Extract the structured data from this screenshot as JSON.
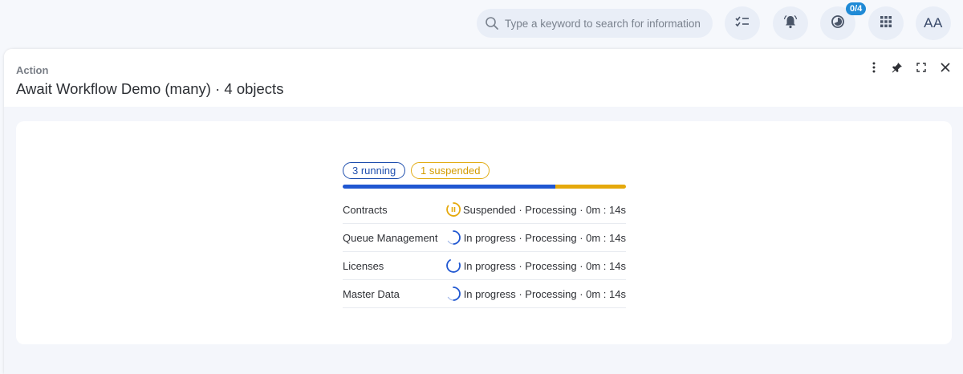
{
  "topbar": {
    "search": {
      "placeholder": "Type a keyword to search for information",
      "icon": "search-icon"
    },
    "buttons": [
      {
        "name": "tasks-button",
        "icon": "checklist-icon"
      },
      {
        "name": "notifications-button",
        "icon": "bell-icon"
      },
      {
        "name": "jobs-button",
        "icon": "progress-icon",
        "badge": "0/4"
      },
      {
        "name": "apps-button",
        "icon": "grid-icon"
      }
    ],
    "avatar": "AA"
  },
  "panel": {
    "crumb": "Action",
    "title": "Await Workflow Demo (many) · 4 objects",
    "actions": [
      "more-icon",
      "pin-icon",
      "expand-icon",
      "close-icon"
    ]
  },
  "summary": {
    "running_label": "3 running",
    "suspended_label": "1 suspended",
    "running_count": 3,
    "suspended_count": 1
  },
  "rows": [
    {
      "name": "Contracts",
      "state": "suspended",
      "status": "Suspended · Processing · 0m : 14s"
    },
    {
      "name": "Queue Management",
      "state": "running",
      "status": "In progress · Processing · 0m : 14s"
    },
    {
      "name": "Licenses",
      "state": "running",
      "status": "In progress · Processing · 0m : 14s"
    },
    {
      "name": "Master Data",
      "state": "running",
      "status": "In progress · Processing · 0m : 14s"
    }
  ],
  "colors": {
    "running": "#2057d1",
    "suspended": "#e5a90c",
    "badge": "#1f8ad6"
  }
}
